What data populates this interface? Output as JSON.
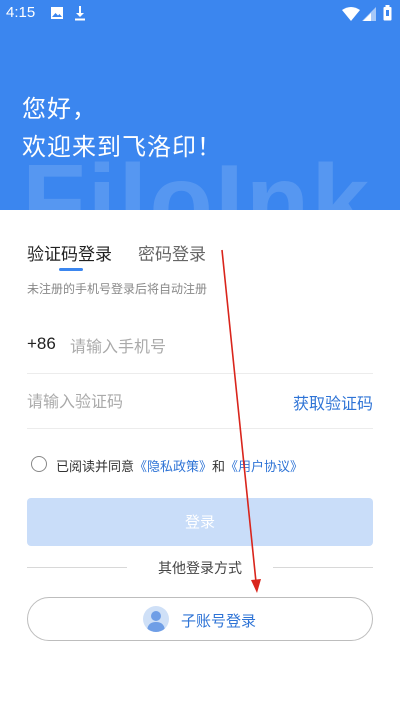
{
  "status_bar": {
    "time": "4:15",
    "left_icons": [
      "image-icon",
      "download-icon"
    ],
    "right_icons": [
      "wifi-icon",
      "signal-icon",
      "battery-icon"
    ]
  },
  "header": {
    "greeting_line1": "您好，",
    "greeting_line2": "欢迎来到飞洛印！",
    "watermark": "FiloInk",
    "background_color": "#3b86ef"
  },
  "tabs": [
    {
      "label": "验证码登录",
      "active": true
    },
    {
      "label": "密码登录",
      "active": false
    }
  ],
  "hint": "未注册的手机号登录后将自动注册",
  "phone": {
    "prefix": "+86",
    "placeholder": "请输入手机号",
    "value": ""
  },
  "code": {
    "placeholder": "请输入验证码",
    "value": "",
    "get_code_label": "获取验证码"
  },
  "agreement": {
    "checked": false,
    "text_before": "已阅读并同意",
    "privacy_link": "《隐私政策》",
    "connector": "和",
    "user_link": "《用户协议》"
  },
  "login_button": "登录",
  "other_methods": "其他登录方式",
  "sub_account_button": "子账号登录",
  "colors": {
    "accent": "#2f74d6",
    "button_disabled": "#c9ddf9",
    "annotation_arrow": "#d9251c"
  }
}
